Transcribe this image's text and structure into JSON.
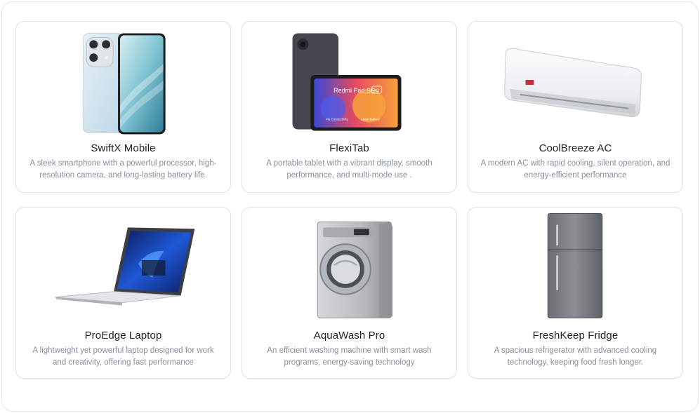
{
  "products": [
    {
      "title": "SwiftX Mobile",
      "description": "A sleek smartphone with a powerful processor, high-resolution camera, and long-lasting battery life.",
      "image": "smartphone-image"
    },
    {
      "title": "FlexiTab",
      "description": "A portable tablet with a vibrant display, smooth performance, and multi-mode use .",
      "image": "tablet-image",
      "image_text": {
        "brand": "Redmi Pad SE",
        "badge": "4G",
        "left": "4G Connectivity",
        "right": "Large Battery"
      }
    },
    {
      "title": "CoolBreeze AC",
      "description": "A modern AC with rapid cooling, silent operation, and energy-efficient performance",
      "image": "air-conditioner-image"
    },
    {
      "title": "ProEdge Laptop",
      "description": "A lightweight yet powerful laptop designed for work and creativity, offering fast performance",
      "image": "laptop-image"
    },
    {
      "title": "AquaWash Pro",
      "description": "An efficient washing machine with smart wash programs, energy-saving technology",
      "image": "washing-machine-image"
    },
    {
      "title": "FreshKeep Fridge",
      "description": "A spacious refrigerator with advanced cooling technology, keeping food fresh longer.",
      "image": "refrigerator-image"
    }
  ]
}
